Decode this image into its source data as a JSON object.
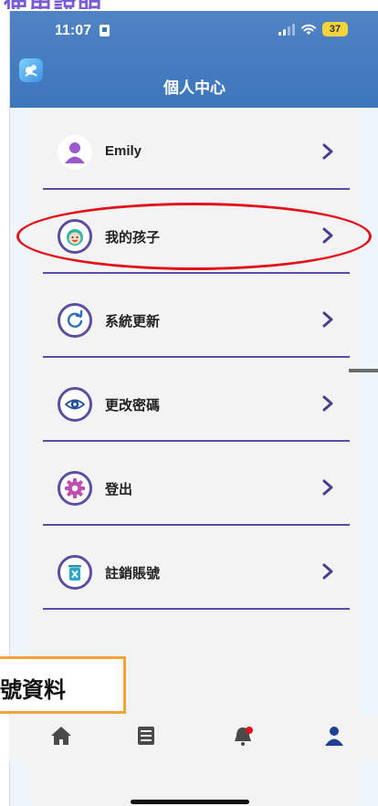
{
  "top_caption": "使用說明",
  "status_bar": {
    "time": "11:07",
    "battery": "37"
  },
  "header": {
    "title": "個人中心"
  },
  "menu": [
    {
      "label": "Emily"
    },
    {
      "label": "我的孩子"
    },
    {
      "label": "系統更新"
    },
    {
      "label": "更改密碼"
    },
    {
      "label": "登出"
    },
    {
      "label": "註銷賬號"
    }
  ],
  "callout": {
    "text": "號資料"
  },
  "colors": {
    "header": "#3e76bc",
    "accent": "#5a4ea3",
    "highlight": "#e2121b",
    "callout_border": "#f2a33a"
  },
  "tabs": [
    "home-icon",
    "list-icon",
    "notification-icon",
    "profile-icon"
  ]
}
